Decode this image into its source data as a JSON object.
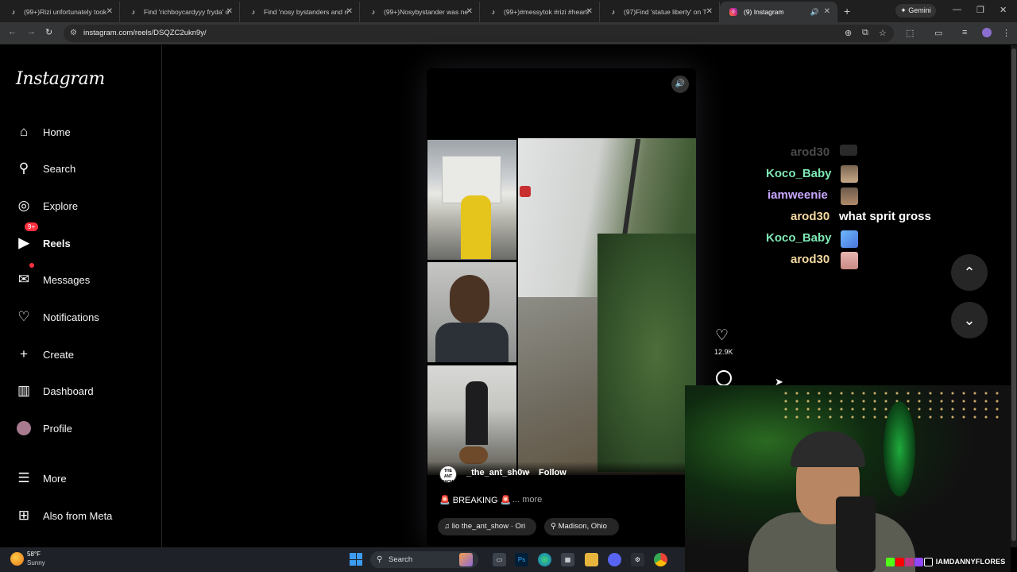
{
  "browser": {
    "tabs": [
      {
        "title": "(99+)Rizi unfortunately took",
        "icon": "tiktok-icon"
      },
      {
        "title": "Find 'richboycardyyy fryda' o",
        "icon": "tiktok-icon"
      },
      {
        "title": "Find 'nosy bystanders and ri",
        "icon": "tiktok-icon"
      },
      {
        "title": "(99+)Nosybystander was ne",
        "icon": "tiktok-icon"
      },
      {
        "title": "(99+)#messytok #rizi #hearti",
        "icon": "tiktok-icon"
      },
      {
        "title": "(97)Find 'statue liberty' on T",
        "icon": "tiktok-icon"
      },
      {
        "title": "(9) Instagram",
        "icon": "instagram-icon",
        "active": true
      }
    ],
    "gemini_label": "Gemini",
    "url": "instagram.com/reels/DSQZC2ukn9y/"
  },
  "sidebar": {
    "logo": "Instagram",
    "items": [
      {
        "label": "Home",
        "icon": "home-icon"
      },
      {
        "label": "Search",
        "icon": "search-icon"
      },
      {
        "label": "Explore",
        "icon": "compass-icon"
      },
      {
        "label": "Reels",
        "icon": "reels-icon",
        "active": true
      },
      {
        "label": "Messages",
        "icon": "messenger-icon",
        "badge": "9+"
      },
      {
        "label": "Notifications",
        "icon": "heart-icon",
        "dot": true
      },
      {
        "label": "Create",
        "icon": "plus-icon"
      },
      {
        "label": "Dashboard",
        "icon": "dashboard-icon"
      },
      {
        "label": "Profile",
        "icon": "avatar-icon"
      },
      {
        "label": "More",
        "icon": "menu-icon"
      },
      {
        "label": "Also from Meta",
        "icon": "meta-icon"
      }
    ]
  },
  "reel": {
    "avatar_text": "THE ANT SHOW",
    "username": "_the_ant_sh0w",
    "separator": "•",
    "follow_label": "Follow",
    "caption": "🚨 BREAKING 🚨",
    "more_label": "... more",
    "audio": "lio  the_ant_show · Ori",
    "location": "Madison, Ohio",
    "likes": "12.9K"
  },
  "chat": [
    {
      "user": "arod30",
      "message": "",
      "color": "#4a4a4a"
    },
    {
      "user": "Koco_Baby",
      "message": "",
      "color": "#7ee8b4"
    },
    {
      "user": "iamweenie",
      "message": "",
      "color": "#c8a8ff"
    },
    {
      "user": "arod30",
      "message": "what sprit gross",
      "color": "#f4d9a0"
    },
    {
      "user": "Koco_Baby",
      "message": "",
      "color": "#7ee8b4"
    },
    {
      "user": "arod30",
      "message": "",
      "color": "#f4d9a0"
    }
  ],
  "webcam": {
    "handle": "IAMDANNYFLORES"
  },
  "taskbar": {
    "temperature": "58°F",
    "condition": "Sunny",
    "search_label": "Search"
  }
}
